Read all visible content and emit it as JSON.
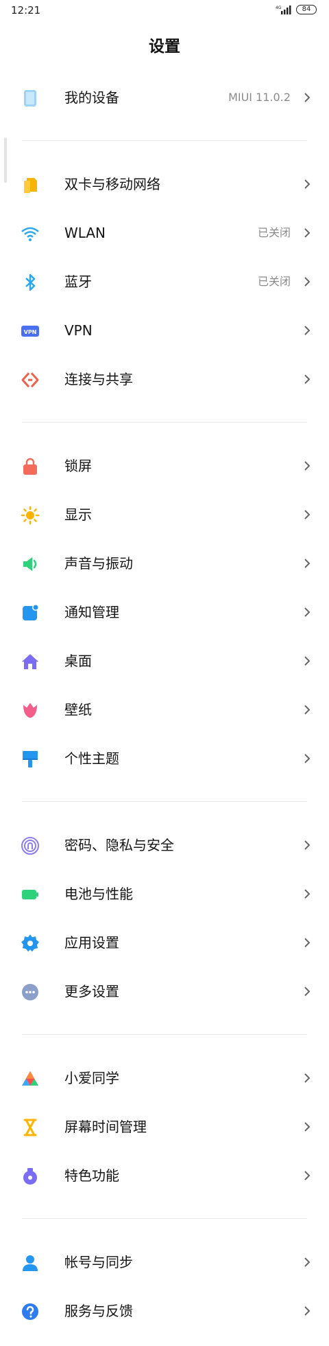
{
  "status_bar": {
    "time": "12:21",
    "network": "4G",
    "battery": "84"
  },
  "page": {
    "title": "设置"
  },
  "items": [
    {
      "label": "我的设备",
      "value": "MIUI 11.0.2",
      "icon": "device-icon"
    },
    {
      "label": "双卡与移动网络",
      "value": "",
      "icon": "sim-card-icon"
    },
    {
      "label": "WLAN",
      "value": "已关闭",
      "icon": "wifi-icon"
    },
    {
      "label": "蓝牙",
      "value": "已关闭",
      "icon": "bluetooth-icon"
    },
    {
      "label": "VPN",
      "value": "",
      "icon": "vpn-icon"
    },
    {
      "label": "连接与共享",
      "value": "",
      "icon": "share-icon"
    },
    {
      "label": "锁屏",
      "value": "",
      "icon": "lock-icon"
    },
    {
      "label": "显示",
      "value": "",
      "icon": "brightness-icon"
    },
    {
      "label": "声音与振动",
      "value": "",
      "icon": "speaker-icon"
    },
    {
      "label": "通知管理",
      "value": "",
      "icon": "notification-icon"
    },
    {
      "label": "桌面",
      "value": "",
      "icon": "home-icon"
    },
    {
      "label": "壁纸",
      "value": "",
      "icon": "flower-icon"
    },
    {
      "label": "个性主题",
      "value": "",
      "icon": "brush-icon"
    },
    {
      "label": "密码、隐私与安全",
      "value": "",
      "icon": "fingerprint-icon"
    },
    {
      "label": "电池与性能",
      "value": "",
      "icon": "battery-icon"
    },
    {
      "label": "应用设置",
      "value": "",
      "icon": "gear-icon"
    },
    {
      "label": "更多设置",
      "value": "",
      "icon": "more-icon"
    },
    {
      "label": "小爱同学",
      "value": "",
      "icon": "assistant-icon"
    },
    {
      "label": "屏幕时间管理",
      "value": "",
      "icon": "hourglass-icon"
    },
    {
      "label": "特色功能",
      "value": "",
      "icon": "special-features-icon"
    },
    {
      "label": "帐号与同步",
      "value": "",
      "icon": "account-icon"
    },
    {
      "label": "服务与反馈",
      "value": "",
      "icon": "help-icon"
    }
  ],
  "colors": {
    "device": "#9fd3f5",
    "sim": "#f7b500",
    "wifi": "#29a8f0",
    "bluetooth": "#29a8f0",
    "vpn": "#4a6ff0",
    "share": "#f2604a",
    "lock": "#f36b5b",
    "display": "#ffb400",
    "sound": "#2dd27a",
    "notification": "#2496f0",
    "home": "#7b6cf6",
    "wallpaper": "#f35f8a",
    "theme": "#2496f0",
    "privacy": "#8b7cf0",
    "battery": "#2dd27a",
    "apps": "#2496f0",
    "more": "#8aa0c8",
    "assistant": "#ff4d4d",
    "screen_time": "#ffb400",
    "features": "#7b6cf6",
    "account": "#2496f0",
    "help": "#2d7cf0"
  }
}
